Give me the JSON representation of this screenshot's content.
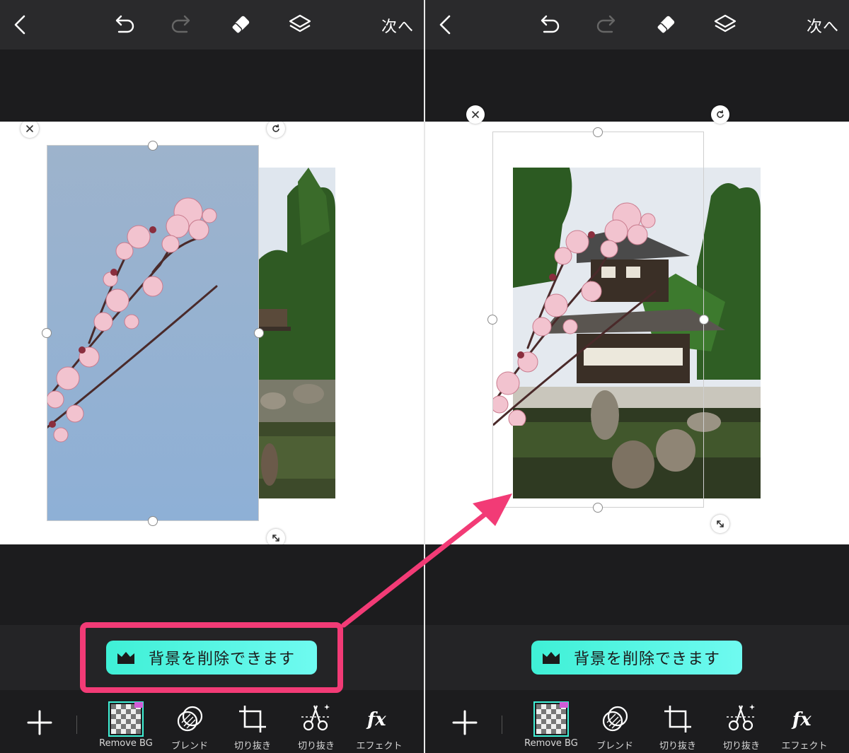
{
  "header": {
    "next_label": "次へ",
    "icons": [
      "back-icon",
      "undo-icon",
      "redo-icon",
      "eraser-icon",
      "layers-icon"
    ]
  },
  "tip": {
    "text": "背景を削除できます",
    "icon": "crown-icon"
  },
  "toolbar": {
    "add_icon": "plus-icon",
    "tools": [
      {
        "label": "Remove BG",
        "icon": "remove-bg-icon",
        "selected": true
      },
      {
        "label": "ブレンド",
        "icon": "blend-icon"
      },
      {
        "label": "切り抜き",
        "icon": "crop-icon"
      },
      {
        "label": "切り抜き",
        "icon": "cutout-scissors-icon"
      },
      {
        "label": "エフェクト",
        "icon": "fx-icon"
      }
    ]
  },
  "colors": {
    "accent": "#3FF0D6",
    "highlight": "#F23B76",
    "bar_bg": "#1C1C1E",
    "canvas_bg": "#FFFFFF",
    "sky": "#8FA8C4"
  }
}
